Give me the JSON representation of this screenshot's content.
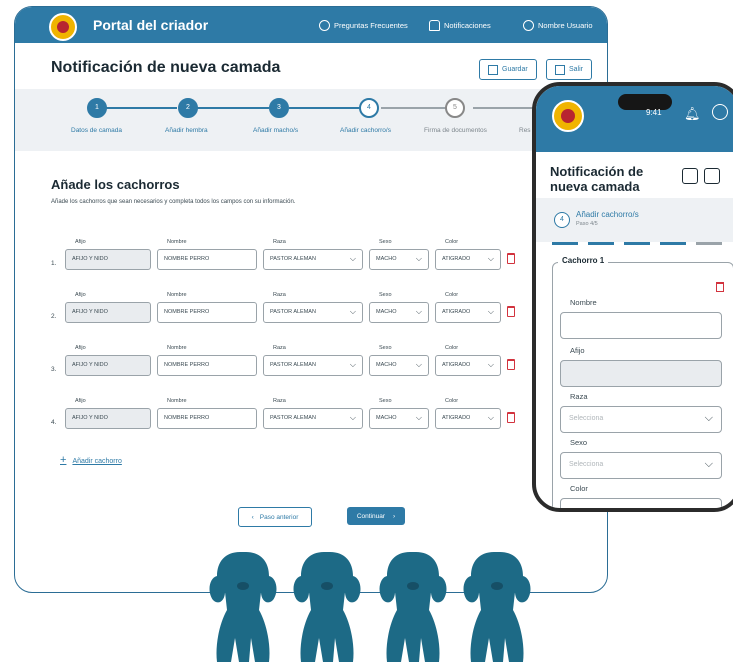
{
  "desktop": {
    "app_name": "Portal del criador",
    "topnav": [
      "Preguntas Frecuentes",
      "Notificaciones",
      "Nombre Usuario"
    ],
    "page_title": "Notificación de nueva camada",
    "save_label": "Guardar",
    "exit_label": "Salir",
    "steps": [
      {
        "num": "1",
        "label": "Datos de camada",
        "state": "done"
      },
      {
        "num": "2",
        "label": "Añadir hembra",
        "state": "done"
      },
      {
        "num": "3",
        "label": "Añadir macho/s",
        "state": "done"
      },
      {
        "num": "4",
        "label": "Añadir cachorro/s",
        "state": "current"
      },
      {
        "num": "5",
        "label": "Firma de documentos",
        "state": "todo"
      },
      {
        "num": "",
        "label": "Res",
        "state": "todo"
      }
    ],
    "section_title": "Añade los cachorros",
    "section_desc": "Añade los cachorros que sean necesarios y completa todos los campos con su información.",
    "columns": [
      "Afijo",
      "Nombre",
      "Raza",
      "Sexo",
      "Color"
    ],
    "rows": [
      {
        "num": "1.",
        "afijo": "AFIJO Y NIDO",
        "nombre": "NOMBRE PERRO",
        "raza": "PASTOR ALEMAN",
        "sexo": "MACHO",
        "color": "ATIGRADO"
      },
      {
        "num": "2.",
        "afijo": "AFIJO Y NIDO",
        "nombre": "NOMBRE PERRO",
        "raza": "PASTOR ALEMAN",
        "sexo": "MACHO",
        "color": "ATIGRADO"
      },
      {
        "num": "3.",
        "afijo": "AFIJO Y NIDO",
        "nombre": "NOMBRE PERRO",
        "raza": "PASTOR ALEMAN",
        "sexo": "MACHO",
        "color": "ATIGRADO"
      },
      {
        "num": "4.",
        "afijo": "AFIJO Y NIDO",
        "nombre": "NOMBRE PERRO",
        "raza": "PASTOR ALEMAN",
        "sexo": "MACHO",
        "color": "ATIGRADO"
      }
    ],
    "add_label": "Añadir cachorro",
    "prev_label": "Paso anterior",
    "next_label": "Continuar"
  },
  "mobile": {
    "time": "9:41",
    "title": "Notificación de nueva camada",
    "step_num": "4",
    "step_name": "Añadir cachorro/s",
    "step_sub": "Paso 4/5",
    "card_title": "Cachorro 1",
    "labels": [
      "Nombre",
      "Afijo",
      "Raza",
      "Sexo",
      "Color"
    ],
    "select_placeholder": "Selecciona"
  },
  "colors": {
    "accent": "#2e7aa6",
    "danger": "#d2333e",
    "frame": "#2b2b2b"
  }
}
